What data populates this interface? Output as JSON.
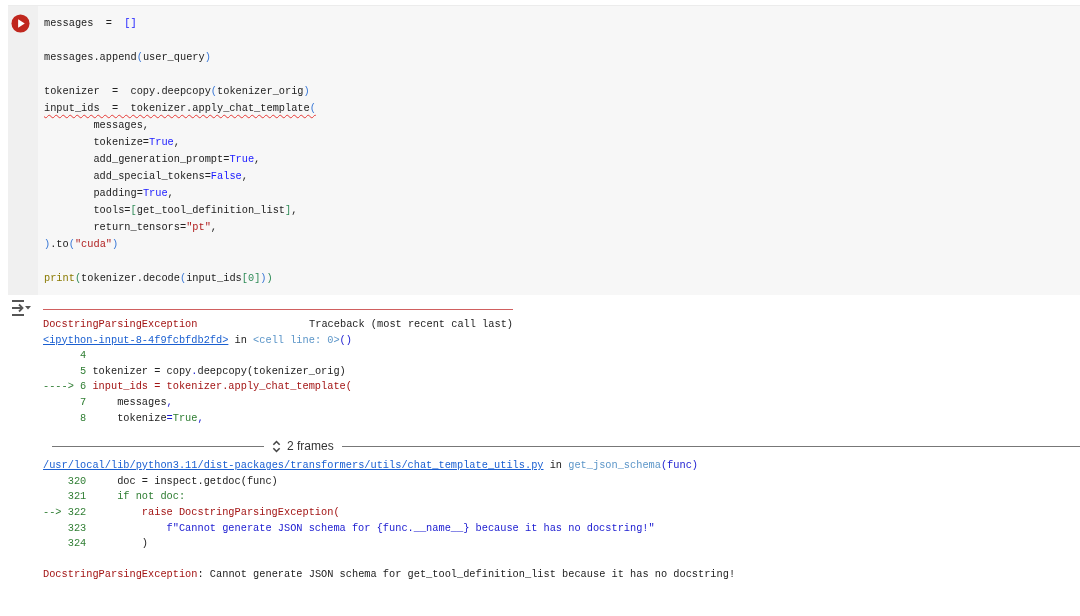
{
  "code_blocks": [
    [
      {
        "underlined": false,
        "segments": [
          {
            "text": "messages  =  ",
            "kind": "plain"
          },
          {
            "text": "[]",
            "kind": "literal"
          }
        ]
      }
    ],
    [
      {
        "underlined": false,
        "segments": [
          {
            "text": "messages.append",
            "kind": "plain"
          },
          {
            "text": "(",
            "kind": "paren"
          },
          {
            "text": "user_query",
            "kind": "plain"
          },
          {
            "text": ")",
            "kind": "paren"
          }
        ]
      }
    ],
    [
      {
        "underlined": false,
        "segments": [
          {
            "text": "tokenizer  =  copy.deepcopy",
            "kind": "plain"
          },
          {
            "text": "(",
            "kind": "paren"
          },
          {
            "text": "tokenizer_orig",
            "kind": "plain"
          },
          {
            "text": ")",
            "kind": "paren"
          }
        ]
      },
      {
        "underlined": true,
        "segments": [
          {
            "text": "input_ids  =  tokenizer.apply_chat_template",
            "kind": "plain"
          },
          {
            "text": "(",
            "kind": "paren"
          }
        ]
      },
      {
        "underlined": false,
        "segments": [
          {
            "text": "        messages,",
            "kind": "plain"
          }
        ]
      },
      {
        "underlined": false,
        "segments": [
          {
            "text": "        tokenize=",
            "kind": "plain"
          },
          {
            "text": "True",
            "kind": "literal"
          },
          {
            "text": ",",
            "kind": "plain"
          }
        ]
      },
      {
        "underlined": false,
        "segments": [
          {
            "text": "        add_generation_prompt=",
            "kind": "plain"
          },
          {
            "text": "True",
            "kind": "literal"
          },
          {
            "text": ",",
            "kind": "plain"
          }
        ]
      },
      {
        "underlined": false,
        "segments": [
          {
            "text": "        add_special_tokens=",
            "kind": "plain"
          },
          {
            "text": "False",
            "kind": "literal"
          },
          {
            "text": ",",
            "kind": "plain"
          }
        ]
      },
      {
        "underlined": false,
        "segments": [
          {
            "text": "        padding=",
            "kind": "plain"
          },
          {
            "text": "True",
            "kind": "literal"
          },
          {
            "text": ",",
            "kind": "plain"
          }
        ]
      },
      {
        "underlined": false,
        "segments": [
          {
            "text": "        tools=",
            "kind": "plain"
          },
          {
            "text": "[",
            "kind": "paren2"
          },
          {
            "text": "get_tool_definition_list",
            "kind": "plain"
          },
          {
            "text": "]",
            "kind": "paren2"
          },
          {
            "text": ",",
            "kind": "plain"
          }
        ]
      },
      {
        "underlined": false,
        "segments": [
          {
            "text": "        return_tensors=",
            "kind": "plain"
          },
          {
            "text": "\"pt\"",
            "kind": "string"
          },
          {
            "text": ",",
            "kind": "plain"
          }
        ]
      },
      {
        "underlined": false,
        "segments": [
          {
            "text": ")",
            "kind": "paren"
          },
          {
            "text": ".to",
            "kind": "plain"
          },
          {
            "text": "(",
            "kind": "paren"
          },
          {
            "text": "\"cuda\"",
            "kind": "string"
          },
          {
            "text": ")",
            "kind": "paren"
          }
        ]
      }
    ],
    [
      {
        "underlined": false,
        "segments": [
          {
            "text": "print",
            "kind": "builtin"
          },
          {
            "text": "(",
            "kind": "paren2"
          },
          {
            "text": "tokenizer.decode",
            "kind": "plain"
          },
          {
            "text": "(",
            "kind": "paren"
          },
          {
            "text": "input_ids",
            "kind": "plain"
          },
          {
            "text": "[",
            "kind": "paren2"
          },
          {
            "text": "0",
            "kind": "paren2"
          },
          {
            "text": "]",
            "kind": "paren2"
          },
          {
            "text": ")",
            "kind": "paren"
          },
          {
            "text": ")",
            "kind": "paren2"
          }
        ]
      }
    ]
  ],
  "output": {
    "exception": "DocstringParsingException",
    "traceback_label": "Traceback (most recent call last)",
    "frames": [
      {
        "location": [
          {
            "text": "<ipython-input-8-4f9fcbfdb2fd>",
            "kind": "link"
          },
          {
            "text": " in ",
            "kind": "plain"
          },
          {
            "text": "<cell line: 0>",
            "kind": "func"
          },
          {
            "text": "()",
            "kind": "call"
          }
        ],
        "lines": [
          {
            "number": "4"
          },
          {
            "number": "5",
            "segments": [
              {
                "text": "tokenizer = copy",
                "kind": "plain"
              },
              {
                "text": ".",
                "kind": "call"
              },
              {
                "text": "deepcopy(tokenizer_orig)",
                "kind": "plain"
              }
            ]
          },
          {
            "arrow": "---->",
            "number": "6",
            "segments": [
              {
                "text": "input_ids = tokenizer.apply_chat_template(",
                "kind": "error"
              }
            ]
          },
          {
            "number": "7",
            "segments": [
              {
                "text": "    messages",
                "kind": "plain"
              },
              {
                "text": ",",
                "kind": "call"
              }
            ]
          },
          {
            "number": "8",
            "segments": [
              {
                "text": "    tokenize",
                "kind": "plain"
              },
              {
                "text": "=",
                "kind": "call"
              },
              {
                "text": "True",
                "kind": "keyword"
              },
              {
                "text": ",",
                "kind": "call"
              }
            ]
          }
        ]
      },
      {
        "collapsed_label": "2 frames",
        "location": [
          {
            "text": "/usr/local/lib/python3.11/dist-packages/transformers/utils/chat_template_utils.py",
            "kind": "link"
          },
          {
            "text": " in ",
            "kind": "plain"
          },
          {
            "text": "get_json_schema",
            "kind": "func"
          },
          {
            "text": "(func)",
            "kind": "call"
          }
        ],
        "lines": [
          {
            "number": "320",
            "segments": [
              {
                "text": "    doc = inspect.getdoc(func)",
                "kind": "plain"
              }
            ]
          },
          {
            "number": "321",
            "segments": [
              {
                "text": "    if not doc:",
                "kind": "keyword"
              }
            ]
          },
          {
            "arrow": "-->",
            "number": "322",
            "segments": [
              {
                "text": "        raise DocstringParsingException(",
                "kind": "error"
              }
            ]
          },
          {
            "number": "323",
            "segments": [
              {
                "text": "            f\"Cannot generate JSON schema for {func.__name__} because it has no docstring!\"",
                "kind": "fstring"
              }
            ]
          },
          {
            "number": "324",
            "segments": [
              {
                "text": "        )",
                "kind": "plain"
              }
            ]
          }
        ]
      }
    ],
    "error_message": [
      {
        "text": "DocstringParsingException",
        "kind": "error"
      },
      {
        "text": ": Cannot generate JSON schema for get_tool_definition_list because it has no docstring!",
        "kind": "plain"
      }
    ]
  }
}
